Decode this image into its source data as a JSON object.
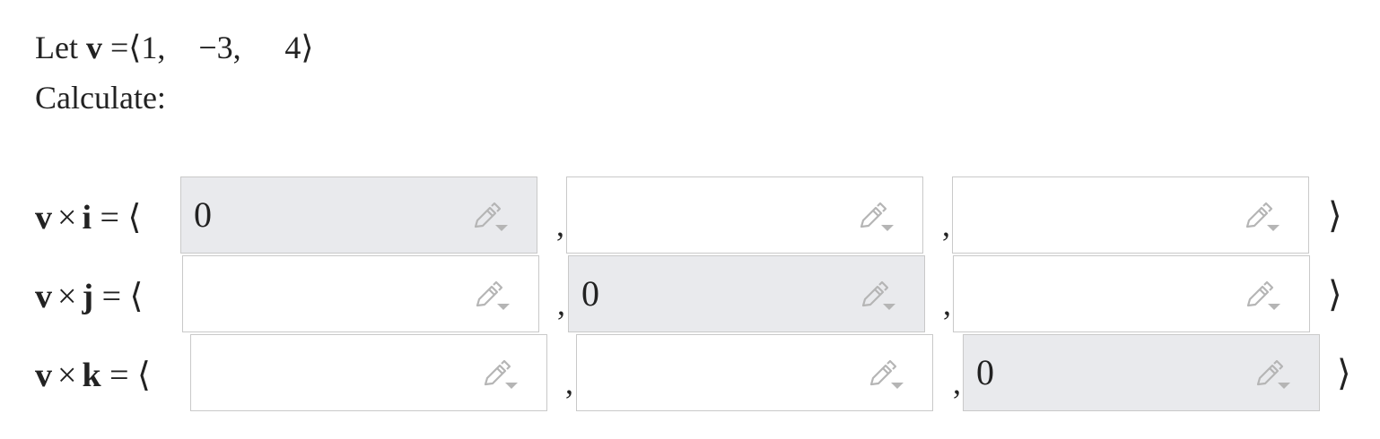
{
  "intro": {
    "let_word": "Let",
    "vector_symbol": "v",
    "equals": "=",
    "open_bracket": "⟨",
    "components": [
      "1,",
      "−3,",
      "4"
    ],
    "close_bracket": "⟩",
    "instruction": "Calculate:"
  },
  "rows": [
    {
      "lhs_v": "v",
      "times": "×",
      "lhs_unit": "i",
      "equals": "=",
      "open": "⟨",
      "close": "⟩",
      "comma": ",",
      "inputs": [
        {
          "value": "0",
          "prefilled": true
        },
        {
          "value": "",
          "prefilled": false
        },
        {
          "value": "",
          "prefilled": false
        }
      ]
    },
    {
      "lhs_v": "v",
      "times": "×",
      "lhs_unit": "j",
      "equals": "=",
      "open": "⟨",
      "close": "⟩",
      "comma": ",",
      "inputs": [
        {
          "value": "",
          "prefilled": false
        },
        {
          "value": "0",
          "prefilled": true
        },
        {
          "value": "",
          "prefilled": false
        }
      ]
    },
    {
      "lhs_v": "v",
      "times": "×",
      "lhs_unit": "k",
      "equals": "=",
      "open": "⟨",
      "close": "⟩",
      "comma": ",",
      "inputs": [
        {
          "value": "",
          "prefilled": false
        },
        {
          "value": "",
          "prefilled": false
        },
        {
          "value": "0",
          "prefilled": true
        }
      ]
    }
  ],
  "icons": {
    "input_icon": "pencil-dropdown-icon"
  },
  "colors": {
    "prefilled_bg": "#e9eaed",
    "border": "#c9c9c9",
    "icon": "#b5b5b5"
  }
}
